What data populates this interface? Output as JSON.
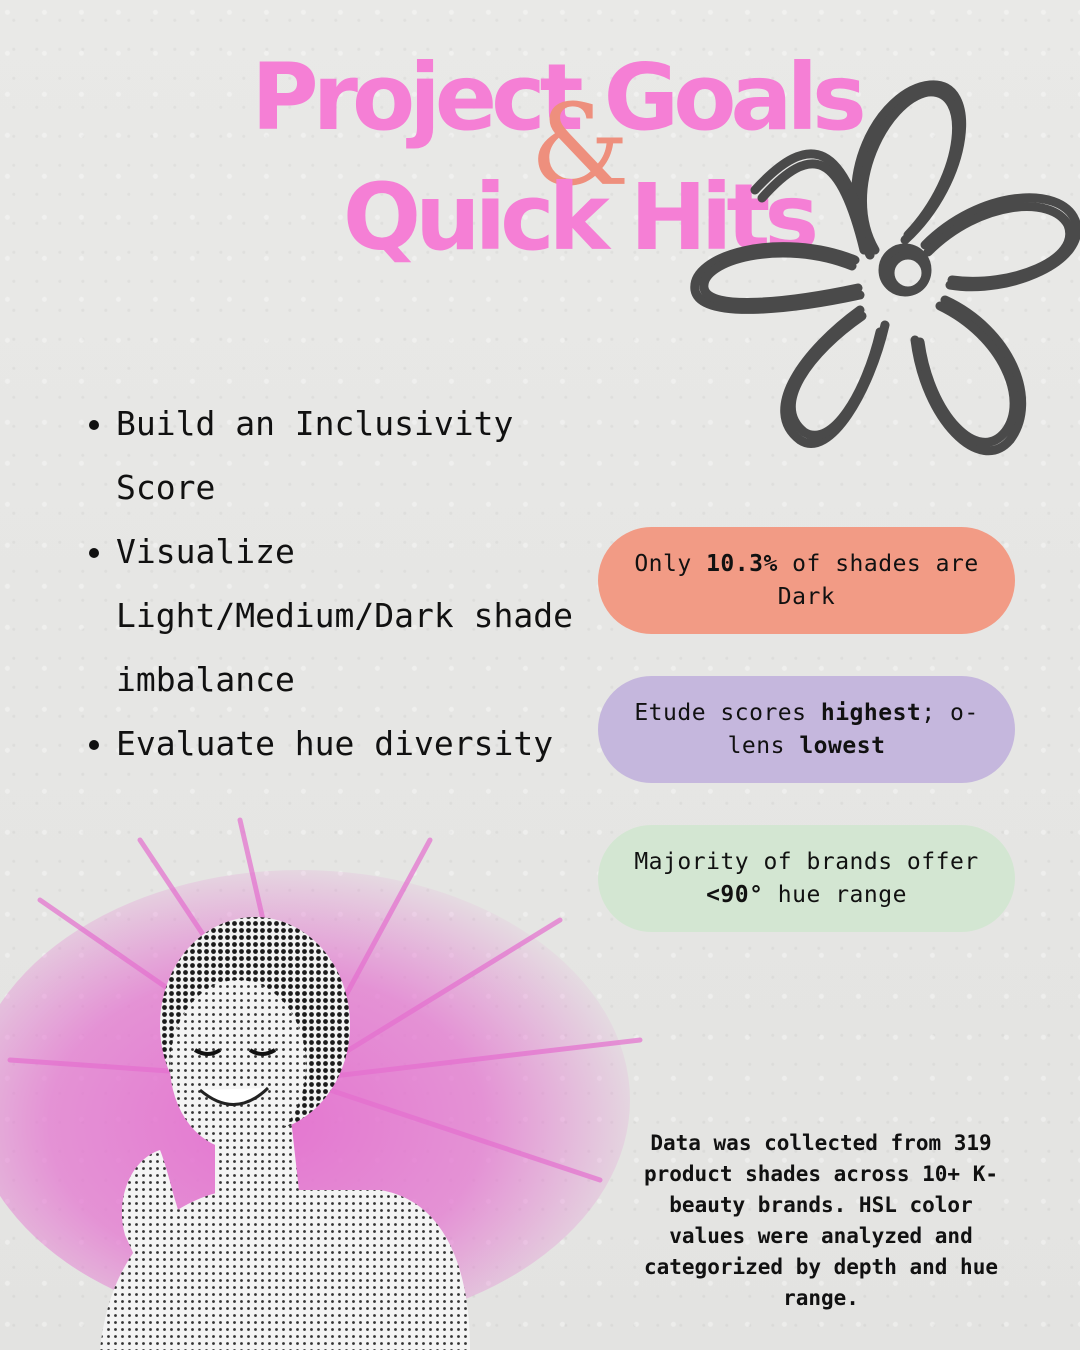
{
  "title": {
    "line1": "Project Goals",
    "ampersand": "&",
    "line2": "Quick Hits"
  },
  "goals": [
    "Build an Inclusivity Score",
    "Visualize Light/Medium/Dark shade imbalance",
    "Evaluate hue diversity"
  ],
  "quick_hits": [
    {
      "before": "Only ",
      "strong": "10.3%",
      "after": " of shades are Dark",
      "color": "#f29b85"
    },
    {
      "before": "Etude scores ",
      "strong": "highest",
      "mid": "; o-lens ",
      "strong2": "lowest",
      "color": "#c5b7dd"
    },
    {
      "before": "Majority of brands offer ",
      "strong": "<90°",
      "after": " hue range",
      "color": "#d3e6d2"
    }
  ],
  "footnote": "Data was collected from 319 product shades across 10+ K-beauty brands. HSL color values were analyzed and categorized by depth and hue range.",
  "colors": {
    "title_pink": "#f57fd5",
    "ampersand_coral": "#ee8f7d",
    "flower_outline": "#4a4a4a",
    "powder_pink": "#e46fcf"
  },
  "decorations": {
    "flower": "hand-drawn-flower-doodle",
    "photo": "halftone-smiling-woman-with-pink-powder-burst"
  }
}
